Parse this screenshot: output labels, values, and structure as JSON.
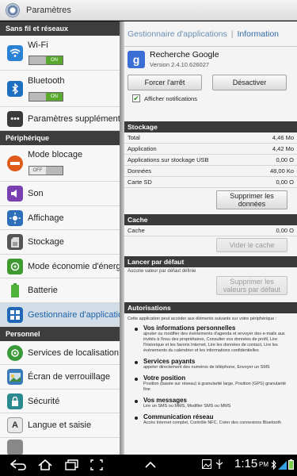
{
  "topbar": {
    "title": "Paramètres"
  },
  "sidebar": {
    "sec_wireless": "Sans fil et réseaux",
    "wifi": {
      "label": "Wi-Fi",
      "toggle": "ON"
    },
    "bluetooth": {
      "label": "Bluetooth",
      "toggle": "ON"
    },
    "more": "Paramètres supplémentaires",
    "sec_device": "Périphérique",
    "blocking": {
      "label": "Mode blocage",
      "toggle": "OFF"
    },
    "sound": "Son",
    "display": "Affichage",
    "storage": "Stockage",
    "power": "Mode économie d'énergie",
    "battery": "Batterie",
    "apps": "Gestionnaire d'applications",
    "sec_personal": "Personnel",
    "location": "Services de localisation",
    "lock": "Écran de verrouillage",
    "security": "Sécurité",
    "language": "Langue et saisie"
  },
  "detail": {
    "breadcrumb": {
      "parent": "Gestionnaire d'applications",
      "current": "Information"
    },
    "app": {
      "name": "Recherche Google",
      "version": "Version 2.4.10.626027"
    },
    "force_stop": "Forcer l'arrêt",
    "disable": "Désactiver",
    "show_notifications": "Afficher notifications",
    "storage": {
      "header": "Stockage",
      "rows": [
        {
          "label": "Total",
          "value": "4,46 Mo"
        },
        {
          "label": "Application",
          "value": "4,42 Mo"
        },
        {
          "label": "Applications sur stockage USB",
          "value": "0,00 O"
        },
        {
          "label": "Données",
          "value": "48,00 Ko"
        },
        {
          "label": "Carte SD",
          "value": "0,00 O"
        }
      ],
      "clear_data_line1": "Supprimer les",
      "clear_data_line2": "données"
    },
    "cache": {
      "header": "Cache",
      "label": "Cache",
      "value": "0,00 O",
      "clear": "Vider le cache"
    },
    "defaults": {
      "header": "Lancer par défaut",
      "note": "Aucune valeur par défaut définie",
      "clear_line1": "Supprimer les",
      "clear_line2": "valeurs par défaut"
    },
    "permissions": {
      "header": "Autorisations",
      "intro": "Cette application peut accéder aux éléments suivants sur votre périphérique :",
      "items": [
        {
          "title": "Vos informations personnelles",
          "desc": "ajouter ou modifier des événements d'agenda et envoyer des e-mails aux invités à l'insu des propriétaires, Consulter vos données de profil, Lire l'historique et les favoris Internet, Lire les données de contact, Lire les événements du calendrier et les informations confidentielles"
        },
        {
          "title": "Services payants",
          "desc": "appeler directement des numéros de téléphone, Envoyer un SMS"
        },
        {
          "title": "Votre position",
          "desc": "Position (basée sur réseau) à granularité large, Position (GPS) granularité fine"
        },
        {
          "title": "Vos messages",
          "desc": "Lire un SMS ou MMS, Modifier SMS ou MMS"
        },
        {
          "title": "Communication réseau",
          "desc": "Accès Internet complet, Contrôle NFC, Créer des connexions Bluetooth"
        }
      ]
    }
  },
  "navbar": {
    "time": "1:15",
    "ampm": "PM"
  }
}
